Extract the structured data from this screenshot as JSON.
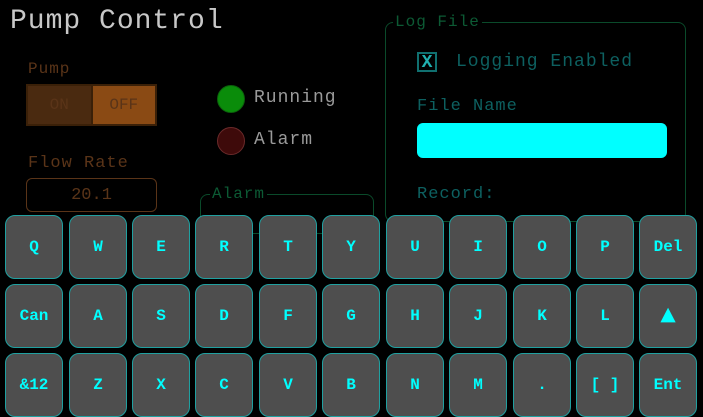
{
  "title": "Pump Control",
  "pump": {
    "label": "Pump",
    "on_label": "ON",
    "off_label": "OFF"
  },
  "flow": {
    "label": "Flow Rate",
    "value": "20.1"
  },
  "indicators": {
    "running_label": "Running",
    "alarm_label": "Alarm"
  },
  "alarm_group": {
    "title": "Alarm"
  },
  "log": {
    "title": "Log File",
    "checkbox_mark": "X",
    "logging_label": "Logging Enabled",
    "file_name_label": "File Name",
    "file_name_value": "",
    "record_label": "Record:"
  },
  "keyboard": {
    "rows": [
      [
        "Q",
        "W",
        "E",
        "R",
        "T",
        "Y",
        "U",
        "I",
        "O",
        "P",
        "Del"
      ],
      [
        "Can",
        "A",
        "S",
        "D",
        "F",
        "G",
        "H",
        "J",
        "K",
        "L",
        "▲"
      ],
      [
        "&12",
        "Z",
        "X",
        "C",
        "V",
        "B",
        "N",
        "M",
        ".",
        "[ ]",
        "Ent"
      ]
    ]
  },
  "colors": {
    "background": "#000000",
    "accent": "#00ffff",
    "key_fill": "#4e4e4e",
    "led_running": "#0a8c0a",
    "led_alarm": "#3e0a0a"
  }
}
